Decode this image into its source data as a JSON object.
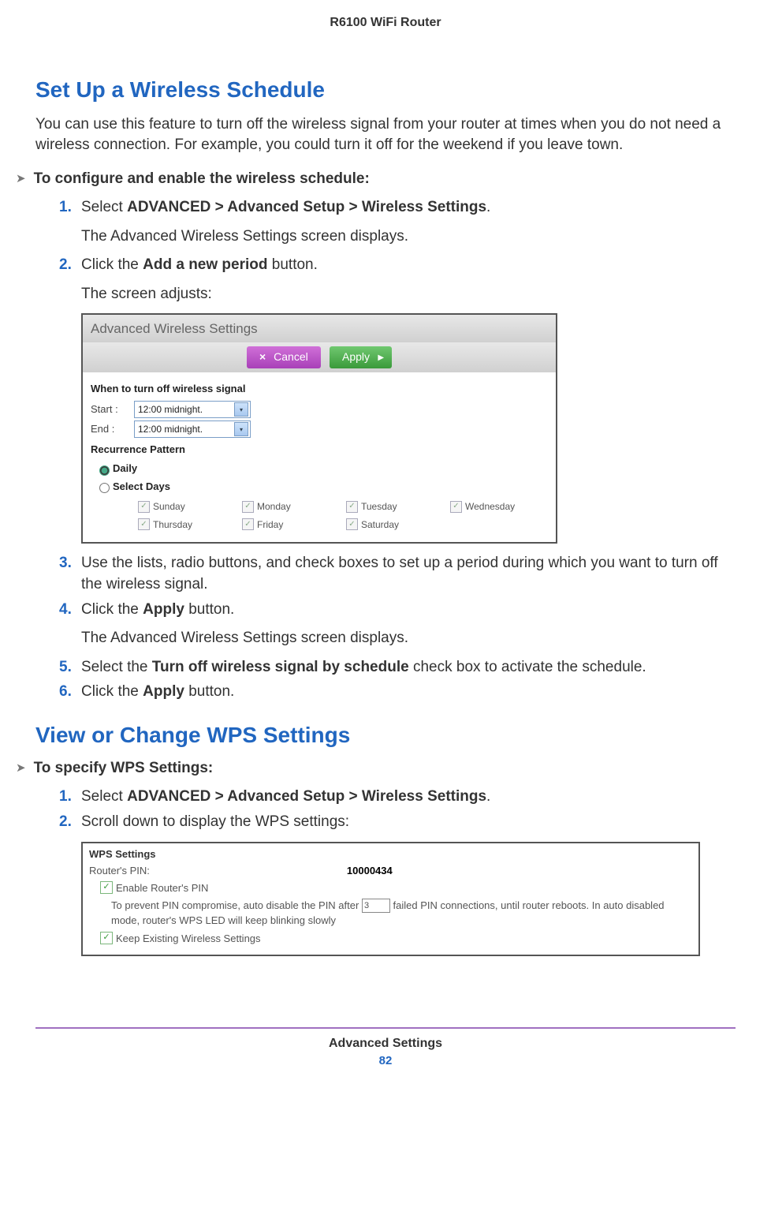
{
  "header": {
    "title": "R6100 WiFi Router"
  },
  "section1": {
    "title": "Set Up a Wireless Schedule",
    "intro": "You can use this feature to turn off the wireless signal from your router at times when you do not need a wireless connection. For example, you could turn it off for the weekend if you leave town.",
    "procLabel": "To configure and enable the wireless schedule:",
    "steps": {
      "s1_a": "Select ",
      "s1_b": "ADVANCED > Advanced Setup > Wireless Settings",
      "s1_c": ".",
      "s1_sub": "The Advanced Wireless Settings screen displays.",
      "s2_a": "Click the ",
      "s2_b": "Add a new period",
      "s2_c": " button.",
      "s2_sub": "The screen adjusts:",
      "s3": "Use the lists, radio buttons, and check boxes to set up a period during which you want to turn off the wireless signal.",
      "s4_a": "Click the ",
      "s4_b": "Apply",
      "s4_c": " button.",
      "s4_sub": "The Advanced Wireless Settings screen displays.",
      "s5_a": "Select the ",
      "s5_b": "Turn off wireless signal by schedule",
      "s5_c": " check box to activate the schedule.",
      "s6_a": "Click the ",
      "s6_b": "Apply",
      "s6_c": " button."
    },
    "nums": {
      "n1": "1.",
      "n2": "2.",
      "n3": "3.",
      "n4": "4.",
      "n5": "5.",
      "n6": "6."
    }
  },
  "ui1": {
    "title": "Advanced Wireless Settings",
    "cancel": "Cancel",
    "apply": "Apply",
    "whenLabel": "When to turn off wireless signal",
    "startLabel": "Start :",
    "endLabel": "End :",
    "startVal": "12:00 midnight.",
    "endVal": "12:00 midnight.",
    "recLabel": "Recurrence Pattern",
    "daily": "Daily",
    "selectDays": "Select Days",
    "days": {
      "sun": "Sunday",
      "mon": "Monday",
      "tue": "Tuesday",
      "wed": "Wednesday",
      "thu": "Thursday",
      "fri": "Friday",
      "sat": "Saturday"
    }
  },
  "section2": {
    "title": "View or Change WPS Settings",
    "procLabel": "To specify WPS Settings:",
    "steps": {
      "s1_a": "Select ",
      "s1_b": "ADVANCED > Advanced Setup > Wireless Settings",
      "s1_c": ".",
      "s2": "Scroll down to display the WPS settings:"
    },
    "nums": {
      "n1": "1.",
      "n2": "2."
    }
  },
  "ui2": {
    "heading": "WPS Settings",
    "pinLabel": "Router's PIN:",
    "pinValue": "10000434",
    "enablePin": "Enable Router's PIN",
    "prevent_a": "To prevent PIN compromise, auto disable the PIN after ",
    "prevent_val": "3",
    "prevent_b": " failed PIN connections, until router reboots. In auto disabled mode, router's WPS LED will keep blinking slowly",
    "keep": "Keep Existing Wireless Settings"
  },
  "footer": {
    "label": "Advanced Settings",
    "page": "82"
  }
}
